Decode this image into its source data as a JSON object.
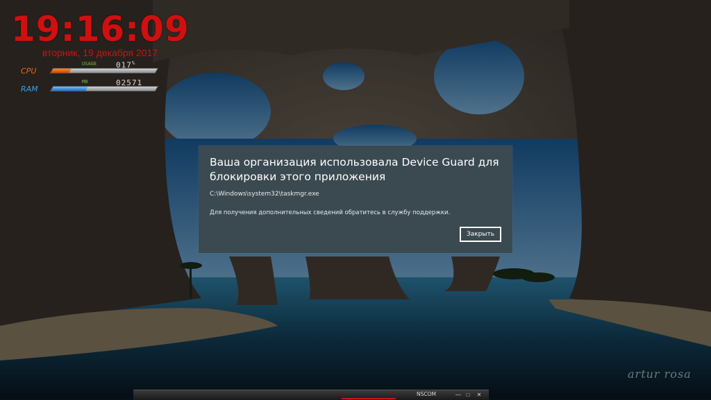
{
  "desktop": {
    "signature": "artur rosa"
  },
  "clock_gadget": {
    "time": "19:16:09",
    "date": "вторник, 19 декабря 2017",
    "color": "#d01010"
  },
  "system_meter": {
    "cpu": {
      "label": "CPU",
      "caption": "USAGE",
      "value": "017",
      "unit": "%",
      "fill_fraction": 0.17,
      "color": "#e66a12"
    },
    "ram": {
      "label": "RAM",
      "caption": "MB",
      "value": "02571",
      "fill_fraction": 0.33,
      "color": "#3d9ee8"
    }
  },
  "dialog": {
    "title": "Ваша организация использовала Device Guard для блокировки этого приложения",
    "path": "C:\\Windows\\system32\\taskmgr.exe",
    "info": "Для получения дополнительных сведений обратитесь в службу поддержки.",
    "close_label": "Закрыть",
    "background": "#3b4a51"
  },
  "taskbar": {
    "task_label": "NSCOM",
    "minimize_icon": "minimize-icon",
    "maximize_icon": "maximize-icon",
    "close_icon": "close-icon"
  }
}
